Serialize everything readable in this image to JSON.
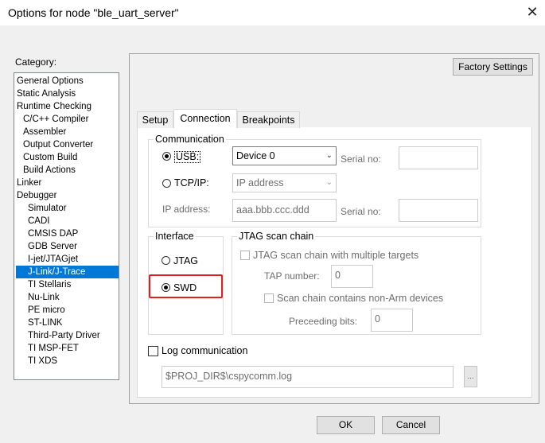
{
  "window": {
    "title": "Options for node \"ble_uart_server\"",
    "close_glyph": "✕"
  },
  "category": {
    "label": "Category:",
    "items": [
      "General Options",
      "Static Analysis",
      "Runtime Checking",
      "C/C++ Compiler",
      "Assembler",
      "Output Converter",
      "Custom Build",
      "Build Actions",
      "Linker",
      "Debugger",
      "Simulator",
      "CADI",
      "CMSIS DAP",
      "GDB Server",
      "I-jet/JTAGjet",
      "J-Link/J-Trace",
      "TI Stellaris",
      "Nu-Link",
      "PE micro",
      "ST-LINK",
      "Third-Party Driver",
      "TI MSP-FET",
      "TI XDS"
    ],
    "selected": "J-Link/J-Trace"
  },
  "factory_button": "Factory Settings",
  "tabs": [
    "Setup",
    "Connection",
    "Breakpoints"
  ],
  "active_tab": "Connection",
  "communication": {
    "legend": "Communication",
    "usb_label": "USB:",
    "usb_device": "Device 0",
    "tcp_label": "TCP/IP:",
    "tcp_mode": "IP address",
    "ip_label": "IP address:",
    "ip_value": "aaa.bbb.ccc.ddd",
    "serial_label": "Serial no:",
    "serial_label_2": "Serial no:"
  },
  "interface": {
    "legend": "Interface",
    "jtag_label": "JTAG",
    "swd_label": "SWD",
    "selected": "SWD"
  },
  "jtag_chain": {
    "legend": "JTAG scan chain",
    "multi_targets_label": "JTAG scan chain with multiple targets",
    "tap_label": "TAP number:",
    "tap_value": "0",
    "non_arm_label": "Scan chain contains non-Arm devices",
    "preceding_label": "Preceeding bits:",
    "preceding_value": "0"
  },
  "log": {
    "label": "Log communication",
    "path": "$PROJ_DIR$\\cspycomm.log",
    "browse": "..."
  },
  "buttons": {
    "ok": "OK",
    "cancel": "Cancel"
  },
  "colors": {
    "selection": "#0078d7",
    "highlight_border": "#e02020"
  }
}
